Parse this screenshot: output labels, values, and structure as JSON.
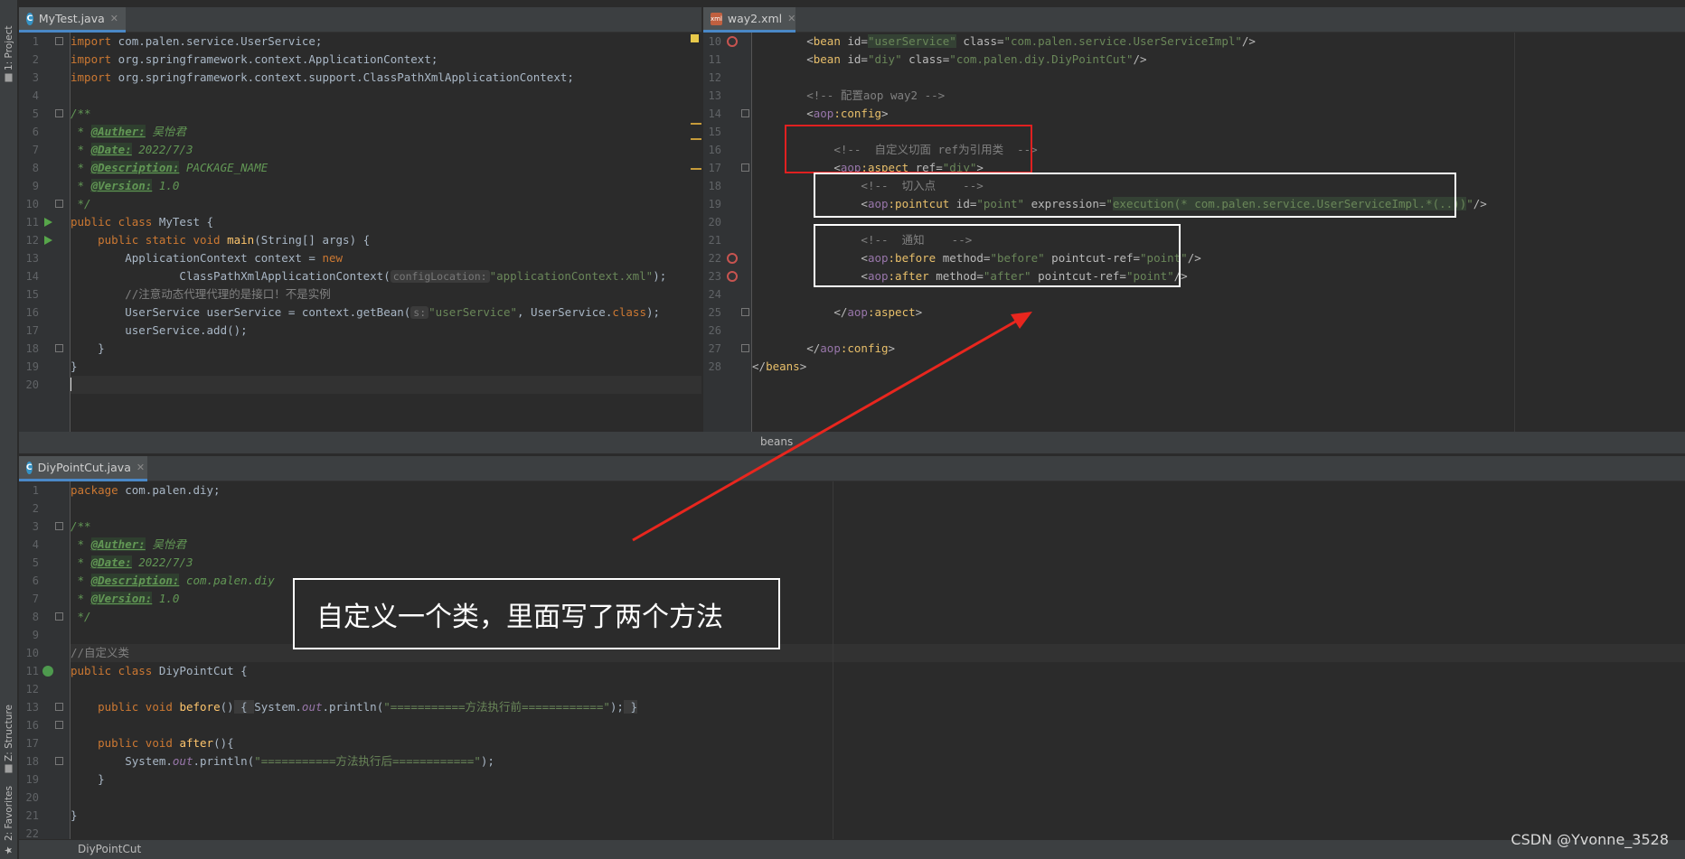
{
  "sidebar": {
    "project_label": "1: Project",
    "structure_label": "Z: Structure",
    "favorites_label": "2: Favorites"
  },
  "editor_left": {
    "tab_name": "MyTest.java",
    "lines": [
      {
        "n": "1"
      },
      {
        "n": "2"
      },
      {
        "n": "3"
      },
      {
        "n": "4"
      },
      {
        "n": "5"
      },
      {
        "n": "6"
      },
      {
        "n": "7"
      },
      {
        "n": "8"
      },
      {
        "n": "9"
      },
      {
        "n": "10"
      },
      {
        "n": "11"
      },
      {
        "n": "12"
      },
      {
        "n": "13"
      },
      {
        "n": "14"
      },
      {
        "n": "15"
      },
      {
        "n": "16"
      },
      {
        "n": "17"
      },
      {
        "n": "18"
      },
      {
        "n": "19"
      },
      {
        "n": "20"
      }
    ],
    "code": {
      "l1_kw": "import",
      "l1_rest": " com.palen.service.UserService;",
      "l2_kw": "import",
      "l2_rest": " org.springframework.context.ApplicationContext;",
      "l3_kw": "import",
      "l3_rest": " org.springframework.context.support.ClassPathXmlApplicationContext;",
      "l5": "/**",
      "l6_star": " * ",
      "l6_tag": "@Auther:",
      "l6_val": " 吴怡君",
      "l7_star": " * ",
      "l7_tag": "@Date:",
      "l7_val": " 2022/7/3",
      "l8_star": " * ",
      "l8_tag": "@Description:",
      "l8_val": " PACKAGE_NAME",
      "l9_star": " * ",
      "l9_tag": "@Version:",
      "l9_val": " 1.0",
      "l10": " */",
      "l11_kw": "public class",
      "l11_rest": " MyTest {",
      "l12_kw": "public static void",
      "l12_fn": "main",
      "l12_rest": "(String[] args) {",
      "l13_rest": "ApplicationContext context = ",
      "l13_kw": "new",
      "l14_rest": "ClassPathXmlApplicationContext(",
      "l14_hint": "configLocation:",
      "l14_str": "\"applicationContext.xml\"",
      "l14_end": ");",
      "l15": "//注意动态代理代理的是接口！不是实例",
      "l16_a": "UserService userService = context.getBean(",
      "l16_hint": "s:",
      "l16_str": "\"userService\"",
      "l16_b": ", UserService.",
      "l16_kw": "class",
      "l16_c": ");",
      "l17": "userService.add();",
      "l18": "}",
      "l19": "}"
    }
  },
  "editor_right": {
    "tab_name": "way2.xml",
    "lines": [
      {
        "n": "10"
      },
      {
        "n": "11"
      },
      {
        "n": "12"
      },
      {
        "n": "13"
      },
      {
        "n": "14"
      },
      {
        "n": "15"
      },
      {
        "n": "16"
      },
      {
        "n": "17"
      },
      {
        "n": "18"
      },
      {
        "n": "19"
      },
      {
        "n": "20"
      },
      {
        "n": "21"
      },
      {
        "n": "22"
      },
      {
        "n": "23"
      },
      {
        "n": "24"
      },
      {
        "n": "25"
      },
      {
        "n": "26"
      },
      {
        "n": "27"
      },
      {
        "n": "28"
      }
    ],
    "code": {
      "l10_a": "<",
      "l10_t": "bean",
      "l10_id": " id=",
      "l10_idv": "\"userService\"",
      "l10_cl": " class=",
      "l10_clv": "\"com.palen.service.UserServiceImpl\"",
      "l10_e": "/>",
      "l11_a": "<",
      "l11_t": "bean",
      "l11_id": " id=",
      "l11_idv": "\"diy\"",
      "l11_cl": " class=",
      "l11_clv": "\"com.palen.diy.DiyPointCut\"",
      "l11_e": "/>",
      "l13": "<!-- 配置aop way2 -->",
      "l14_a": "<",
      "l14_ns": "aop",
      "l14_t": ":config",
      "l14_e": ">",
      "l16": "<!--  自定义切面 ref为引用类  -->",
      "l17_a": "<",
      "l17_ns": "aop",
      "l17_t": ":aspect",
      "l17_r": " ref=",
      "l17_rv": "\"diy\"",
      "l17_e": ">",
      "l18": "<!--  切入点    -->",
      "l19_a": "<",
      "l19_ns": "aop",
      "l19_t": ":pointcut",
      "l19_id": " id=",
      "l19_idv": "\"point\"",
      "l19_ex": " expression=",
      "l19_exv1": "\"",
      "l19_exv2": "execution(* com.palen.service.UserServiceImpl.*(..))",
      "l19_exv3": "\"",
      "l19_e": "/>",
      "l21": "<!--  通知    -->",
      "l22_a": "<",
      "l22_ns": "aop",
      "l22_t": ":before",
      "l22_m": " method=",
      "l22_mv": "\"before\"",
      "l22_p": " pointcut-ref=",
      "l22_pv": "\"point\"",
      "l22_e": "/>",
      "l23_a": "<",
      "l23_ns": "aop",
      "l23_t": ":after",
      "l23_m": " method=",
      "l23_mv": "\"after\"",
      "l23_p": " pointcut-ref=",
      "l23_pv": "\"point\"",
      "l23_e": "/>",
      "l25_a": "</",
      "l25_ns": "aop",
      "l25_t": ":aspect",
      "l25_e": ">",
      "l27_a": "</",
      "l27_ns": "aop",
      "l27_t": ":config",
      "l27_e": ">",
      "l28_a": "</",
      "l28_t": "beans",
      "l28_e": ">"
    },
    "breadcrumb": "beans"
  },
  "editor_bottom": {
    "tab_name": "DiyPointCut.java",
    "lines": [
      {
        "n": "1"
      },
      {
        "n": "2"
      },
      {
        "n": "3"
      },
      {
        "n": "4"
      },
      {
        "n": "5"
      },
      {
        "n": "6"
      },
      {
        "n": "7"
      },
      {
        "n": "8"
      },
      {
        "n": "9"
      },
      {
        "n": "10"
      },
      {
        "n": "11"
      },
      {
        "n": "12"
      },
      {
        "n": "13"
      },
      {
        "n": "16"
      },
      {
        "n": "17"
      },
      {
        "n": "18"
      },
      {
        "n": "19"
      },
      {
        "n": "20"
      },
      {
        "n": "21"
      },
      {
        "n": "22"
      }
    ],
    "code": {
      "l1_kw": "package",
      "l1_rest": " com.palen.diy;",
      "l3": "/**",
      "l4_star": " * ",
      "l4_tag": "@Auther:",
      "l4_val": " 吴怡君",
      "l5_star": " * ",
      "l5_tag": "@Date:",
      "l5_val": " 2022/7/3",
      "l6_star": " * ",
      "l6_tag": "@Description:",
      "l6_val": " com.palen.diy",
      "l7_star": " * ",
      "l7_tag": "@Version:",
      "l7_val": " 1.0",
      "l8": " */",
      "l10": "//自定义类",
      "l11_kw": "public class",
      "l11_rest": " DiyPointCut {",
      "l13_kw": "public void",
      "l13_fn": "before",
      "l13_p": "()",
      "l13_b1": " { ",
      "l13_sys": "System.",
      "l13_out": "out",
      "l13_pr": ".println(",
      "l13_str": "\"===========方法执行前============\"",
      "l13_end": ");",
      "l13_b2": " }",
      "l16_kw": "public void",
      "l16_fn": "after",
      "l16_p": "(){",
      "l17_sys": "System.",
      "l17_out": "out",
      "l17_pr": ".println(",
      "l17_str": "\"===========方法执行后============\"",
      "l17_end": ");",
      "l18": "}",
      "l20": "}"
    },
    "breadcrumb": "DiyPointCut"
  },
  "annotation": {
    "note_text": "自定义一个类，里面写了两个方法",
    "watermark": "CSDN @Yvonne_3528"
  },
  "colors": {
    "red_box": "#e02020",
    "white_box": "#ffffff",
    "arrow": "#e8261e"
  }
}
